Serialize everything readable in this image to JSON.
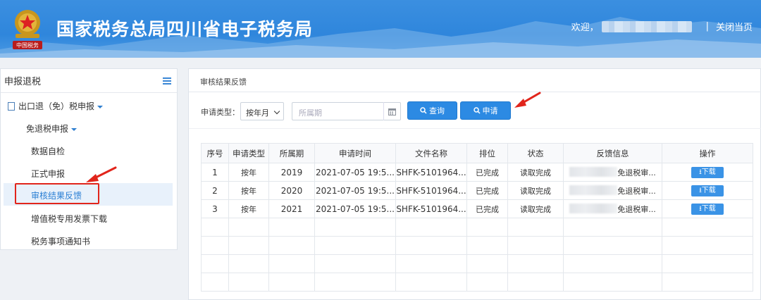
{
  "header": {
    "title": "国家税务总局四川省电子税务局",
    "welcome": "欢迎，",
    "separator": "|",
    "close_label": "关闭当页",
    "emblem_caption": "中国税务"
  },
  "sidebar": {
    "title": "申报退税",
    "items": [
      {
        "label": "出口退（免）税申报"
      },
      {
        "label": "免退税申报"
      },
      {
        "label": "数据自检"
      },
      {
        "label": "正式申报"
      },
      {
        "label": "审核结果反馈"
      },
      {
        "label": "增值税专用发票下载"
      },
      {
        "label": "税务事项通知书"
      }
    ]
  },
  "main": {
    "breadcrumb": "审核结果反馈",
    "filter": {
      "type_label": "申请类型：",
      "type_value": "按年月",
      "period_placeholder": "所属期",
      "query_label": "查询",
      "apply_label": "申请"
    },
    "table": {
      "headers": [
        "序号",
        "申请类型",
        "所属期",
        "申请时间",
        "文件名称",
        "排位",
        "状态",
        "反馈信息",
        "操作"
      ],
      "rows": [
        {
          "no": "1",
          "type": "按年",
          "period": "2019",
          "time": "2021-07-05 19:5...",
          "file": "SHFK-5101964...",
          "rank": "已完成",
          "status": "读取完成",
          "feedback": "免退税审...",
          "action": "下载"
        },
        {
          "no": "2",
          "type": "按年",
          "period": "2020",
          "time": "2021-07-05 19:5...",
          "file": "SHFK-5101964...",
          "rank": "已完成",
          "status": "读取完成",
          "feedback": "免退税审...",
          "action": "下载"
        },
        {
          "no": "3",
          "type": "按年",
          "period": "2021",
          "time": "2021-07-05 19:5...",
          "file": "SHFK-5101964...",
          "rank": "已完成",
          "status": "读取完成",
          "feedback": "免退税审...",
          "action": "下载"
        }
      ]
    }
  },
  "colors": {
    "header_blue": "#2f86dc",
    "button_blue": "#2c8ae3",
    "highlight_red": "#e1251b"
  }
}
